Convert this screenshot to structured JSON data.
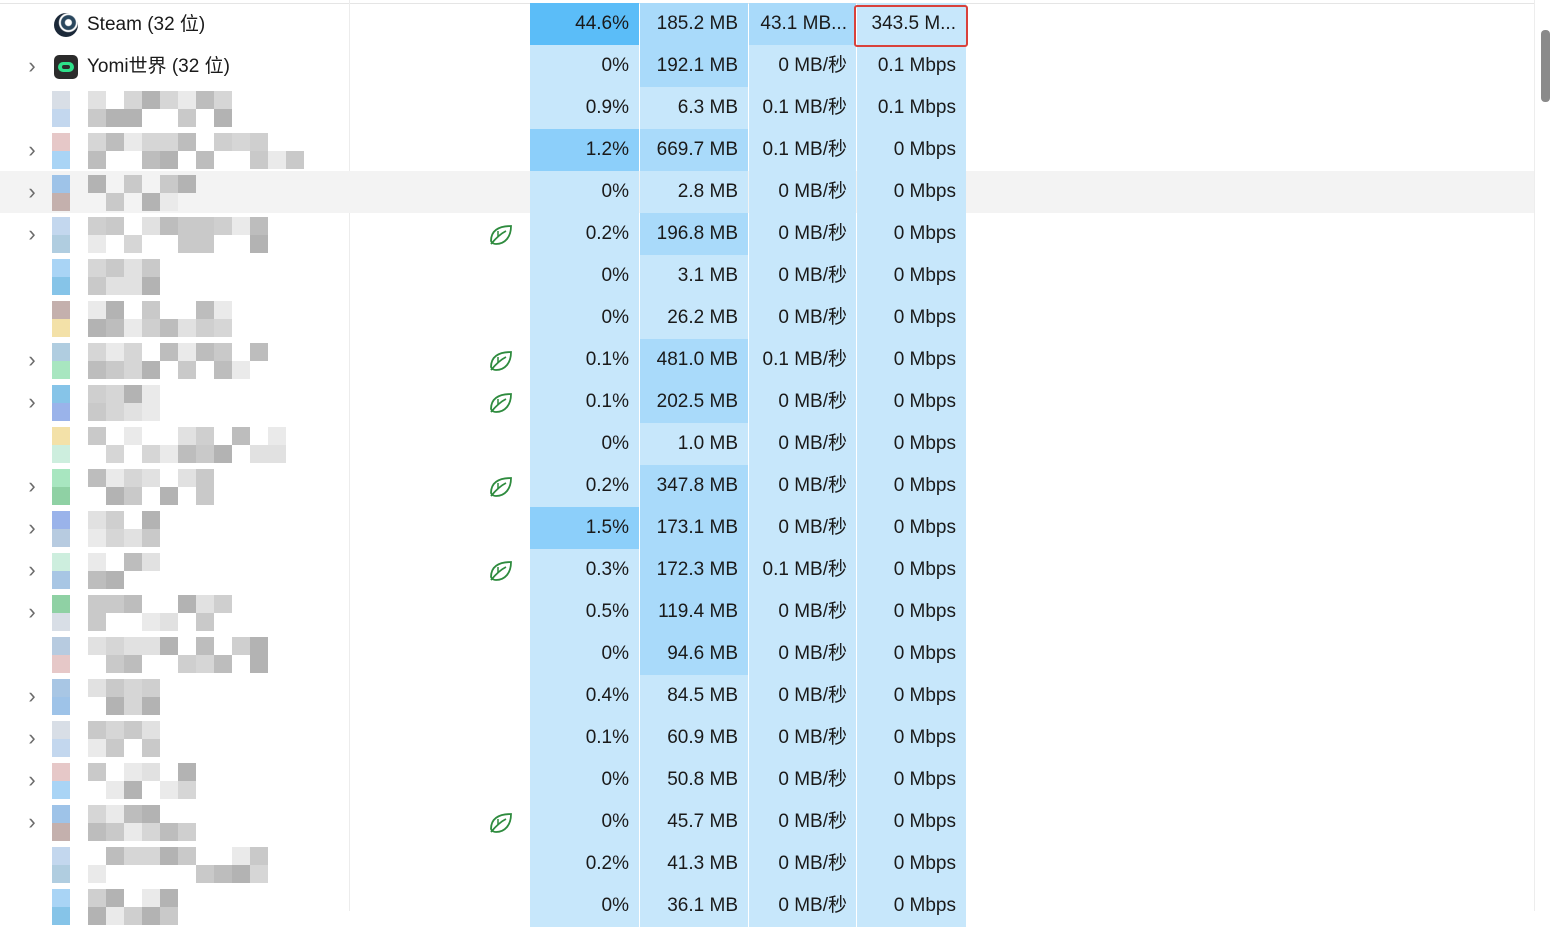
{
  "rows": [
    {
      "name": "Steam (32 位)",
      "icon": "steam-icon",
      "expand": false,
      "eco": false,
      "cpu": "44.6%",
      "mem": "185.2 MB",
      "disk": "43.1 MB...",
      "net": "343.5 M...",
      "cpu_lvl": 4,
      "mem_lvl": 2,
      "disk_lvl": 2,
      "net_lvl": 1
    },
    {
      "name": "Yomi世界 (32 位)",
      "icon": "yomi-icon",
      "expand": true,
      "eco": false,
      "cpu": "0%",
      "mem": "192.1 MB",
      "disk": "0 MB/秒",
      "net": "0.1 Mbps",
      "cpu_lvl": 1,
      "mem_lvl": 2,
      "disk_lvl": 1,
      "net_lvl": 1
    },
    {
      "name": "",
      "expand": false,
      "eco": false,
      "cpu": "0.9%",
      "mem": "6.3 MB",
      "disk": "0.1 MB/秒",
      "net": "0.1 Mbps",
      "cpu_lvl": 1,
      "mem_lvl": 1,
      "disk_lvl": 1,
      "net_lvl": 1
    },
    {
      "name": "",
      "expand": true,
      "eco": false,
      "cpu": "1.2%",
      "mem": "669.7 MB",
      "disk": "0.1 MB/秒",
      "net": "0 Mbps",
      "cpu_lvl": 3,
      "mem_lvl": 2,
      "disk_lvl": 1,
      "net_lvl": 1
    },
    {
      "name": "",
      "expand": true,
      "eco": false,
      "highlight": true,
      "cpu": "0%",
      "mem": "2.8 MB",
      "disk": "0 MB/秒",
      "net": "0 Mbps",
      "cpu_lvl": 1,
      "mem_lvl": 1,
      "disk_lvl": 1,
      "net_lvl": 1
    },
    {
      "name": "",
      "expand": true,
      "eco": true,
      "cpu": "0.2%",
      "mem": "196.8 MB",
      "disk": "0 MB/秒",
      "net": "0 Mbps",
      "cpu_lvl": 1,
      "mem_lvl": 2,
      "disk_lvl": 1,
      "net_lvl": 1
    },
    {
      "name": "",
      "expand": false,
      "eco": false,
      "cpu": "0%",
      "mem": "3.1 MB",
      "disk": "0 MB/秒",
      "net": "0 Mbps",
      "cpu_lvl": 1,
      "mem_lvl": 1,
      "disk_lvl": 1,
      "net_lvl": 1
    },
    {
      "name": "",
      "expand": false,
      "eco": false,
      "cpu": "0%",
      "mem": "26.2 MB",
      "disk": "0 MB/秒",
      "net": "0 Mbps",
      "cpu_lvl": 1,
      "mem_lvl": 1,
      "disk_lvl": 1,
      "net_lvl": 1
    },
    {
      "name": "",
      "expand": true,
      "eco": true,
      "cpu": "0.1%",
      "mem": "481.0 MB",
      "disk": "0.1 MB/秒",
      "net": "0 Mbps",
      "cpu_lvl": 1,
      "mem_lvl": 2,
      "disk_lvl": 1,
      "net_lvl": 1
    },
    {
      "name": "",
      "expand": true,
      "eco": true,
      "cpu": "0.1%",
      "mem": "202.5 MB",
      "disk": "0 MB/秒",
      "net": "0 Mbps",
      "cpu_lvl": 1,
      "mem_lvl": 2,
      "disk_lvl": 1,
      "net_lvl": 1
    },
    {
      "name": "",
      "expand": false,
      "eco": false,
      "cpu": "0%",
      "mem": "1.0 MB",
      "disk": "0 MB/秒",
      "net": "0 Mbps",
      "cpu_lvl": 1,
      "mem_lvl": 1,
      "disk_lvl": 1,
      "net_lvl": 1
    },
    {
      "name": "",
      "expand": true,
      "eco": true,
      "cpu": "0.2%",
      "mem": "347.8 MB",
      "disk": "0 MB/秒",
      "net": "0 Mbps",
      "cpu_lvl": 1,
      "mem_lvl": 2,
      "disk_lvl": 1,
      "net_lvl": 1
    },
    {
      "name": "",
      "expand": true,
      "eco": false,
      "cpu": "1.5%",
      "mem": "173.1 MB",
      "disk": "0 MB/秒",
      "net": "0 Mbps",
      "cpu_lvl": 3,
      "mem_lvl": 2,
      "disk_lvl": 1,
      "net_lvl": 1
    },
    {
      "name": "",
      "expand": true,
      "eco": true,
      "cpu": "0.3%",
      "mem": "172.3 MB",
      "disk": "0.1 MB/秒",
      "net": "0 Mbps",
      "cpu_lvl": 1,
      "mem_lvl": 2,
      "disk_lvl": 1,
      "net_lvl": 1
    },
    {
      "name": "",
      "expand": true,
      "eco": false,
      "cpu": "0.5%",
      "mem": "119.4 MB",
      "disk": "0 MB/秒",
      "net": "0 Mbps",
      "cpu_lvl": 1,
      "mem_lvl": 2,
      "disk_lvl": 1,
      "net_lvl": 1
    },
    {
      "name": "",
      "expand": false,
      "eco": false,
      "cpu": "0%",
      "mem": "94.6 MB",
      "disk": "0 MB/秒",
      "net": "0 Mbps",
      "cpu_lvl": 1,
      "mem_lvl": 2,
      "disk_lvl": 1,
      "net_lvl": 1
    },
    {
      "name": "",
      "expand": true,
      "eco": false,
      "cpu": "0.4%",
      "mem": "84.5 MB",
      "disk": "0 MB/秒",
      "net": "0 Mbps",
      "cpu_lvl": 1,
      "mem_lvl": 1,
      "disk_lvl": 1,
      "net_lvl": 1
    },
    {
      "name": "",
      "expand": true,
      "eco": false,
      "cpu": "0.1%",
      "mem": "60.9 MB",
      "disk": "0 MB/秒",
      "net": "0 Mbps",
      "cpu_lvl": 1,
      "mem_lvl": 1,
      "disk_lvl": 1,
      "net_lvl": 1
    },
    {
      "name": "",
      "expand": true,
      "eco": false,
      "cpu": "0%",
      "mem": "50.8 MB",
      "disk": "0 MB/秒",
      "net": "0 Mbps",
      "cpu_lvl": 1,
      "mem_lvl": 1,
      "disk_lvl": 1,
      "net_lvl": 1
    },
    {
      "name": "",
      "expand": true,
      "eco": true,
      "cpu": "0%",
      "mem": "45.7 MB",
      "disk": "0 MB/秒",
      "net": "0 Mbps",
      "cpu_lvl": 1,
      "mem_lvl": 1,
      "disk_lvl": 1,
      "net_lvl": 1
    },
    {
      "name": "",
      "expand": false,
      "eco": false,
      "cpu": "0.2%",
      "mem": "41.3 MB",
      "disk": "0 MB/秒",
      "net": "0 Mbps",
      "cpu_lvl": 1,
      "mem_lvl": 1,
      "disk_lvl": 1,
      "net_lvl": 1
    },
    {
      "name": "",
      "expand": false,
      "eco": false,
      "cpu": "0%",
      "mem": "36.1 MB",
      "disk": "0 MB/秒",
      "net": "0 Mbps",
      "cpu_lvl": 1,
      "mem_lvl": 1,
      "disk_lvl": 1,
      "net_lvl": 1
    }
  ],
  "selected_cell": {
    "row": 0,
    "column": "net"
  },
  "colors": {
    "highlight_border": "#d9413b",
    "eco_leaf": "#2e8b3e",
    "heat_low": "#c7e7fb",
    "heat_high": "#5bbdf8"
  }
}
